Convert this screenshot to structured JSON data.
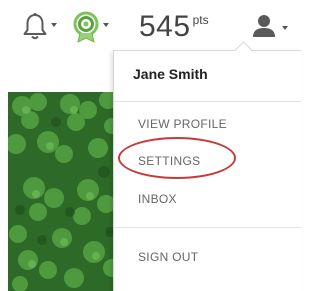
{
  "header": {
    "notifications_icon": "bell-icon",
    "badge_icon": "award-badge-icon",
    "points_value": "545",
    "points_unit": "pts",
    "account_icon": "user-icon"
  },
  "user_menu": {
    "user_name": "Jane Smith",
    "items": [
      {
        "label": "VIEW PROFILE"
      },
      {
        "label": "SETTINGS"
      },
      {
        "label": "INBOX"
      },
      {
        "label": "SIGN OUT"
      }
    ]
  },
  "colors": {
    "highlight": "#c83a3a",
    "badge_green": "#6fb84d",
    "text_muted": "#666666"
  }
}
